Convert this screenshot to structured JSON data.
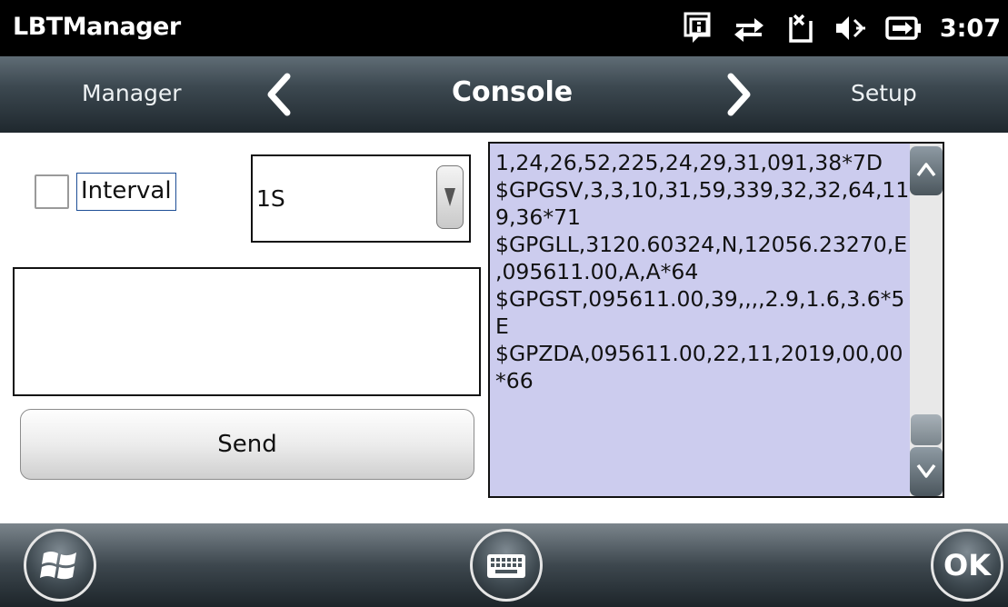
{
  "titlebar": {
    "app_title": "LBTManager",
    "clock": "3:07",
    "icons": [
      "notification-icon",
      "connectivity-icon",
      "no-signal-icon",
      "volume-icon",
      "battery-charging-icon"
    ]
  },
  "navbar": {
    "prev_label": "Manager",
    "current_label": "Console",
    "next_label": "Setup"
  },
  "controls": {
    "interval_label": "Interval",
    "interval_checked": false,
    "interval_value": "1S",
    "command_value": "",
    "send_label": "Send"
  },
  "console": {
    "lines": [
      "1,24,26,52,225,24,29,31,091,38*7D",
      "$GPGSV,3,3,10,31,59,339,32,32,64,11",
      "9,36*71",
      "$GPGLL,3120.60324,N,12056.23270,E",
      ",095611.00,A,A*64",
      "$GPGST,095611.00,39,,,,2.9,1.6,3.6*5",
      "E",
      "$GPZDA,095611.00,22,11,2019,00,00",
      "*66"
    ]
  },
  "bottombar": {
    "ok_label": "OK"
  },
  "colors": {
    "console_background": "#ccccee",
    "titlebar": "#000000",
    "focus_border": "#1e4f96"
  }
}
